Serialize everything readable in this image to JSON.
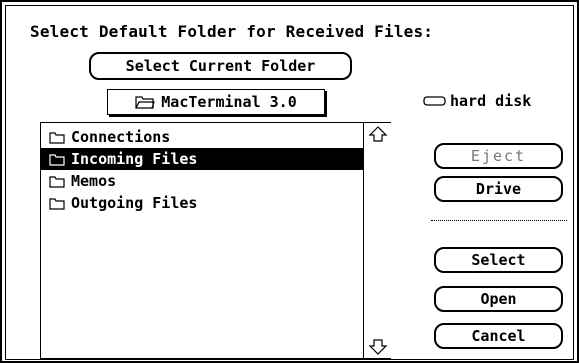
{
  "dialog": {
    "title": "Select Default Folder for Received Files:",
    "select_current_folder_label": "Select Current Folder",
    "current_folder": "MacTerminal 3.0",
    "disk_name": "hard disk"
  },
  "file_list": {
    "items": [
      {
        "label": "Connections",
        "icon": "folder-icon",
        "selected": false
      },
      {
        "label": "Incoming Files",
        "icon": "folder-icon",
        "selected": true
      },
      {
        "label": "Memos",
        "icon": "folder-icon",
        "selected": false
      },
      {
        "label": "Outgoing Files",
        "icon": "folder-icon",
        "selected": false
      }
    ]
  },
  "buttons": {
    "eject_label": "Eject",
    "drive_label": "Drive",
    "select_label": "Select",
    "open_label": "Open",
    "cancel_label": "Cancel"
  },
  "colors": {
    "selection_background": "#000000",
    "selection_text": "#ffffff",
    "disabled_text": "#777777"
  }
}
